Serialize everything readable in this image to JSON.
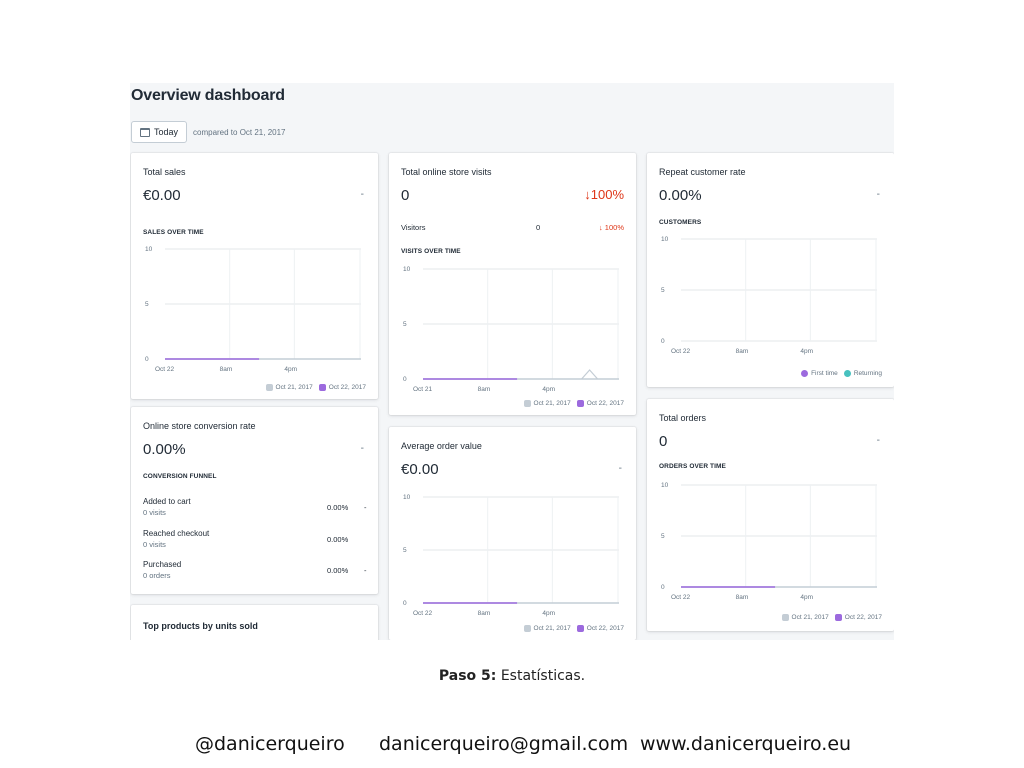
{
  "page_title": "Overview dashboard",
  "date_button": "Today",
  "compared_text": "compared to Oct 21, 2017",
  "legend_colors": {
    "prev": "#c4cdd5",
    "current": "#9c6ade",
    "first_time": "#9c6ade",
    "returning": "#47c1bf"
  },
  "cards": {
    "total_sales": {
      "title": "Total sales",
      "value": "€0.00",
      "dash": "-",
      "sub": "SALES OVER TIME",
      "y_ticks": [
        "10",
        "5",
        "0"
      ],
      "x_ticks": [
        "Oct 22",
        "8am",
        "4pm"
      ],
      "legend": [
        "Oct 21, 2017",
        "Oct 22, 2017"
      ]
    },
    "visits": {
      "title": "Total online store visits",
      "value": "0",
      "change": "↓100%",
      "visitors_label": "Visitors",
      "visitors_value": "0",
      "visitors_change": "↓ 100%",
      "sub": "VISITS OVER TIME",
      "y_ticks": [
        "10",
        "5",
        "0"
      ],
      "x_ticks": [
        "Oct 21",
        "8am",
        "4pm"
      ],
      "legend": [
        "Oct 21, 2017",
        "Oct 22, 2017"
      ]
    },
    "repeat": {
      "title": "Repeat customer rate",
      "value": "0.00%",
      "dash": "-",
      "sub": "CUSTOMERS",
      "y_ticks": [
        "10",
        "5",
        "0"
      ],
      "x_ticks": [
        "Oct 22",
        "8am",
        "4pm"
      ],
      "legend": [
        "First time",
        "Returning"
      ]
    },
    "conversion": {
      "title": "Online store conversion rate",
      "value": "0.00%",
      "dash": "-",
      "sub": "CONVERSION FUNNEL",
      "rows": [
        {
          "label": "Added to cart",
          "sub": "0 visits",
          "value": "0.00%",
          "dash": "-"
        },
        {
          "label": "Reached checkout",
          "sub": "0 visits",
          "value": "0.00%",
          "dash": ""
        },
        {
          "label": "Purchased",
          "sub": "0 orders",
          "value": "0.00%",
          "dash": "-"
        }
      ]
    },
    "aov": {
      "title": "Average order value",
      "value": "€0.00",
      "dash": "-",
      "y_ticks": [
        "10",
        "5",
        "0"
      ],
      "x_ticks": [
        "Oct 22",
        "8am",
        "4pm"
      ],
      "legend": [
        "Oct 21, 2017",
        "Oct 22, 2017"
      ]
    },
    "orders": {
      "title": "Total orders",
      "value": "0",
      "dash": "-",
      "sub": "ORDERS OVER TIME",
      "y_ticks": [
        "10",
        "5",
        "0"
      ],
      "x_ticks": [
        "Oct 22",
        "8am",
        "4pm"
      ],
      "legend": [
        "Oct 21, 2017",
        "Oct 22, 2017"
      ]
    },
    "top_products": {
      "title": "Top products by units sold"
    }
  },
  "caption": {
    "bold": "Paso 5:",
    "text": " Estatísticas."
  },
  "footer": {
    "handle": "@danicerqueiro",
    "email": "danicerqueiro@gmail.com",
    "website": "www.danicerqueiro.eu"
  }
}
